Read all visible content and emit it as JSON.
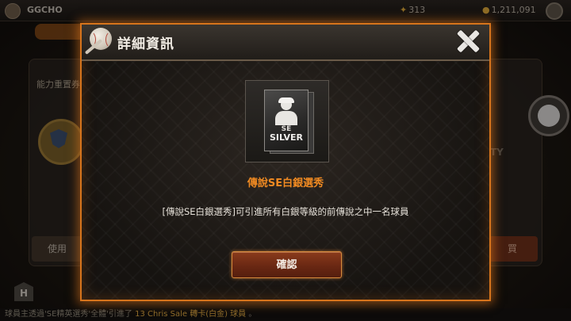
{
  "background": {
    "player_name": "GGCHO",
    "stat_energy": "313",
    "stat_currency": "1,211,091",
    "section_label": "能力重置券",
    "right_text": "TY",
    "use_button": "使用",
    "right_button": "買",
    "home_icon_letter": "H",
    "ticker_prefix": "球員主透過'SE精英選秀'全體'引進了",
    "ticker_highlight": "13 Chris Sale 轉卡(白金) 球員",
    "ticker_suffix": "。"
  },
  "modal": {
    "title": "詳細資訊",
    "card": {
      "tier_se": "SE",
      "tier_silver": "SILVER"
    },
    "item_name": "傳說SE白銀選秀",
    "description": "[傳說SE白銀選秀]可引進所有白銀等級的前傳說之中一名球員",
    "confirm_label": "確認"
  },
  "colors": {
    "accent_orange": "#d6741c",
    "item_name_orange": "#f08a22",
    "confirm_button": "#6a2813"
  }
}
